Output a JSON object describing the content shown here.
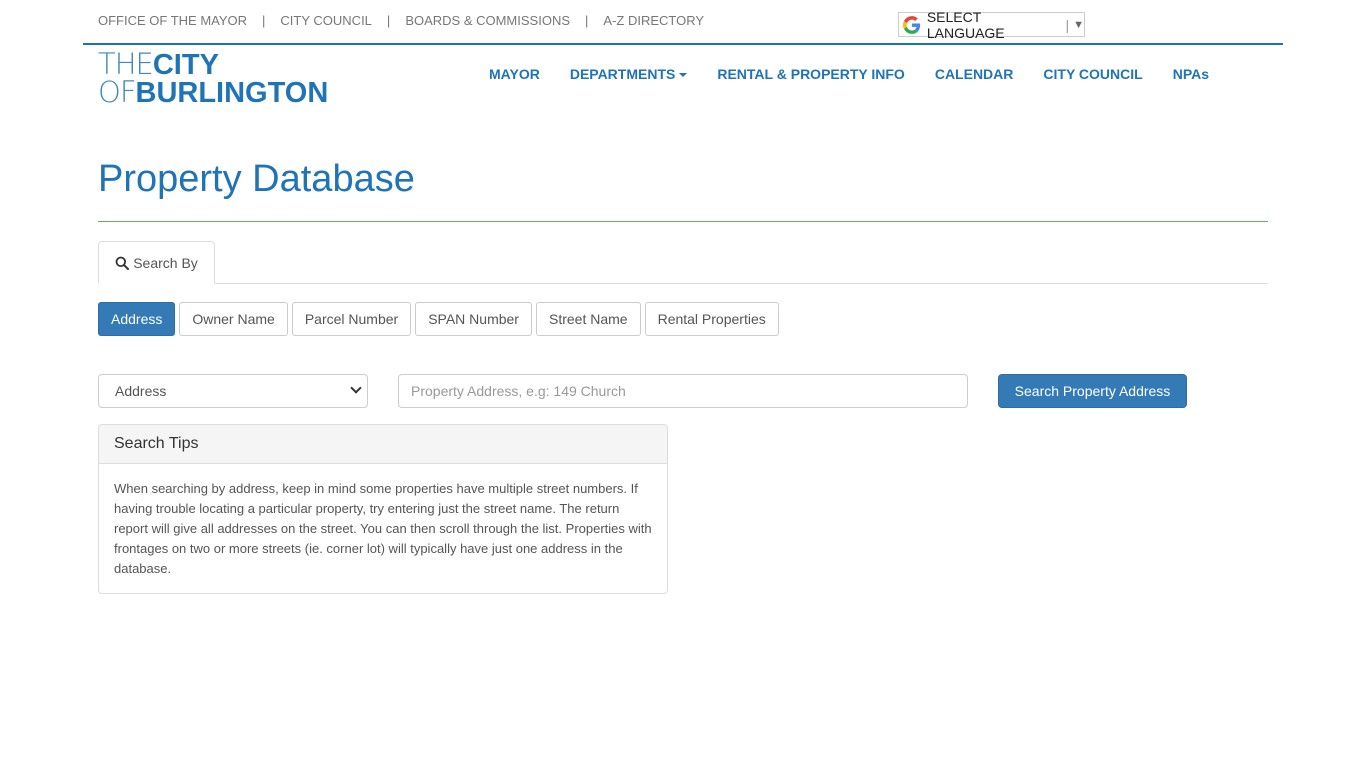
{
  "utility": {
    "links": [
      "OFFICE OF THE MAYOR",
      "CITY COUNCIL",
      "BOARDS & COMMISSIONS",
      "A-Z DIRECTORY"
    ],
    "separator": "|"
  },
  "language": {
    "label": "SELECT LANGUAGE",
    "divider": "|",
    "arrow": "▼"
  },
  "logo": {
    "line1_thin": "THE",
    "line1_bold": "CITY",
    "line2_thin": "OF",
    "line2_bold": "BURLINGTON"
  },
  "nav": {
    "items": [
      "MAYOR",
      "DEPARTMENTS",
      "RENTAL & PROPERTY INFO",
      "CALENDAR",
      "CITY COUNCIL",
      "NPAs"
    ]
  },
  "page": {
    "title": "Property Database"
  },
  "tabs": {
    "search_by": "Search By"
  },
  "search_types": [
    "Address",
    "Owner Name",
    "Parcel Number",
    "SPAN Number",
    "Street Name",
    "Rental Properties"
  ],
  "search": {
    "select_value": "Address",
    "input_placeholder": "Property Address, e.g: 149 Church",
    "button_label": "Search Property Address"
  },
  "tips": {
    "heading": "Search Tips",
    "body": "When searching by address, keep in mind some properties have multiple street numbers. If having trouble locating a particular property, try entering just the street name. The return report will give all addresses on the street. You can then scroll through the list. Properties with frontages on two or more streets (ie. corner lot) will typically have just one address in the database."
  },
  "colors": {
    "brand_blue": "#1f73b7",
    "button_blue": "#337ab7",
    "rule_green": "#5cb85c"
  }
}
